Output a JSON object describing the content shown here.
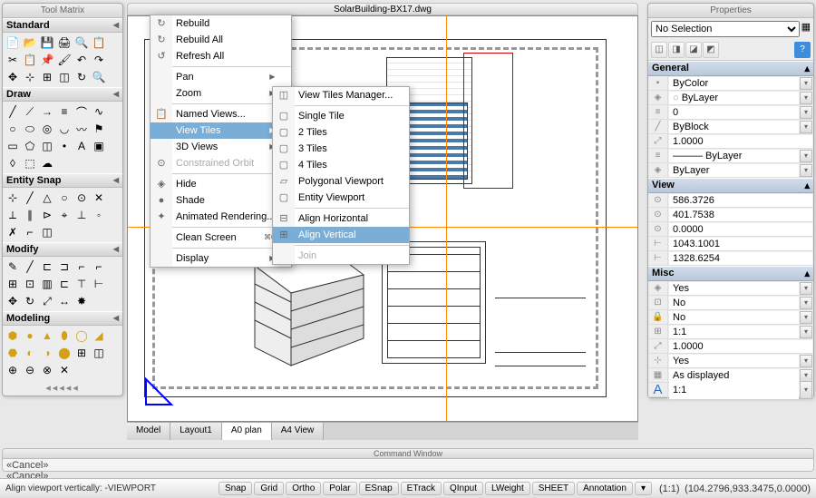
{
  "doc_title": "SolarBuilding-BX17.dwg",
  "tool_matrix": {
    "title": "Tool Matrix",
    "sections": [
      "Standard",
      "Draw",
      "Entity Snap",
      "Modify",
      "Modeling"
    ]
  },
  "tabs": [
    "Model",
    "Layout1",
    "A0 plan",
    "A4 View"
  ],
  "active_tab": 2,
  "menu1": {
    "items": [
      {
        "label": "Rebuild",
        "icon": "↻"
      },
      {
        "label": "Rebuild All",
        "icon": "↻"
      },
      {
        "label": "Refresh All",
        "icon": "↺"
      },
      "sep",
      {
        "label": "Pan",
        "sub": true
      },
      {
        "label": "Zoom",
        "sub": true
      },
      "sep",
      {
        "label": "Named Views...",
        "icon": "📋"
      },
      {
        "label": "View Tiles",
        "sub": true,
        "highlight": true
      },
      {
        "label": "3D Views",
        "sub": true
      },
      {
        "label": "Constrained Orbit",
        "icon": "⊙",
        "disabled": true
      },
      "sep",
      {
        "label": "Hide",
        "icon": "◈"
      },
      {
        "label": "Shade",
        "icon": "●"
      },
      {
        "label": "Animated Rendering...",
        "icon": "✦"
      },
      "sep",
      {
        "label": "Clean Screen",
        "shortcut": "⌘0"
      },
      "sep",
      {
        "label": "Display",
        "sub": true
      }
    ]
  },
  "menu2": {
    "items": [
      {
        "label": "View Tiles Manager...",
        "icon": "◫"
      },
      "sep",
      {
        "label": "Single Tile",
        "icon": "▢"
      },
      {
        "label": "2 Tiles",
        "icon": "▢"
      },
      {
        "label": "3 Tiles",
        "icon": "▢"
      },
      {
        "label": "4 Tiles",
        "icon": "▢"
      },
      {
        "label": "Polygonal Viewport",
        "icon": "▱"
      },
      {
        "label": "Entity Viewport",
        "icon": "▢"
      },
      "sep",
      {
        "label": "Align Horizontal",
        "icon": "⊟"
      },
      {
        "label": "Align Vertical",
        "icon": "⊞",
        "highlight": true
      },
      "sep",
      {
        "label": "Join",
        "disabled": true
      }
    ]
  },
  "properties": {
    "title": "Properties",
    "selection": "No Selection",
    "general": {
      "header": "General",
      "color": "ByColor",
      "layer": "ByLayer",
      "level": "0",
      "linetype": "ByBlock",
      "scale": "1.0000",
      "dash": "——— ByLayer",
      "layer2": "ByLayer"
    },
    "view": {
      "header": "View",
      "v1": "586.3726",
      "v2": "401.7538",
      "v3": "0.0000",
      "v4": "1043.1001",
      "v5": "1328.6254"
    },
    "misc": {
      "header": "Misc",
      "m1": "Yes",
      "m2": "No",
      "m3": "No",
      "m4": "1:1",
      "m5": "1.0000",
      "m6": "Yes",
      "m7": "As displayed",
      "m8": "1:1"
    }
  },
  "cmd_window": {
    "title": "Command Window",
    "line": "«Cancel»"
  },
  "status": {
    "left": "Align viewport vertically: -VIEWPORT",
    "buttons": [
      "Snap",
      "Grid",
      "Ortho",
      "Polar",
      "ESnap",
      "ETrack",
      "QInput",
      "LWeight",
      "SHEET",
      "Annotation"
    ],
    "ratio": "(1:1)",
    "coords": "(104.2796,933.3475,0.0000)"
  }
}
